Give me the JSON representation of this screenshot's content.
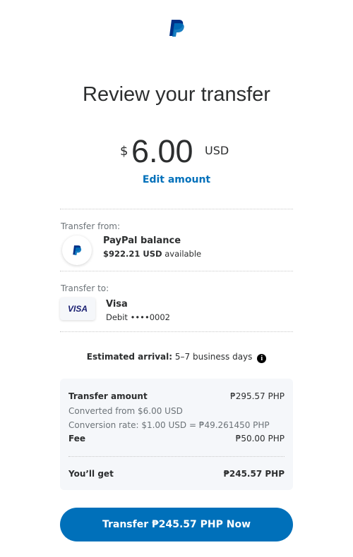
{
  "header": {
    "logo_icon": "paypal-logo-icon",
    "title": "Review your transfer"
  },
  "amount": {
    "currency_symbol": "$",
    "value": "6.00",
    "currency_code": "USD",
    "edit_label": "Edit amount"
  },
  "transfer_from": {
    "label": "Transfer from:",
    "icon": "paypal-logo-icon",
    "name": "PayPal balance",
    "balance": "$922.21 USD",
    "balance_suffix": "available"
  },
  "transfer_to": {
    "label": "Transfer to:",
    "card_brand": "VISA",
    "name": "Visa",
    "detail": "Debit ••••0002"
  },
  "arrival": {
    "label": "Estimated arrival:",
    "value": "5–7 business days",
    "icon": "info-icon"
  },
  "summary": {
    "transfer_amount_label": "Transfer amount",
    "transfer_amount_value": "₱295.57 PHP",
    "converted_from": "Converted from $6.00 USD",
    "conversion_rate": "Conversion rate: $1.00 USD = ₱49.261450 PHP",
    "fee_label": "Fee",
    "fee_value": "₱50.00 PHP",
    "you_get_label": "You’ll get",
    "you_get_value": "₱245.57 PHP"
  },
  "cta": {
    "label": "Transfer ₱245.57 PHP Now"
  },
  "colors": {
    "brand_blue": "#0070ba",
    "brand_navy": "#003087",
    "visa_navy": "#1a1f71",
    "summary_bg": "#f5f7fa"
  }
}
